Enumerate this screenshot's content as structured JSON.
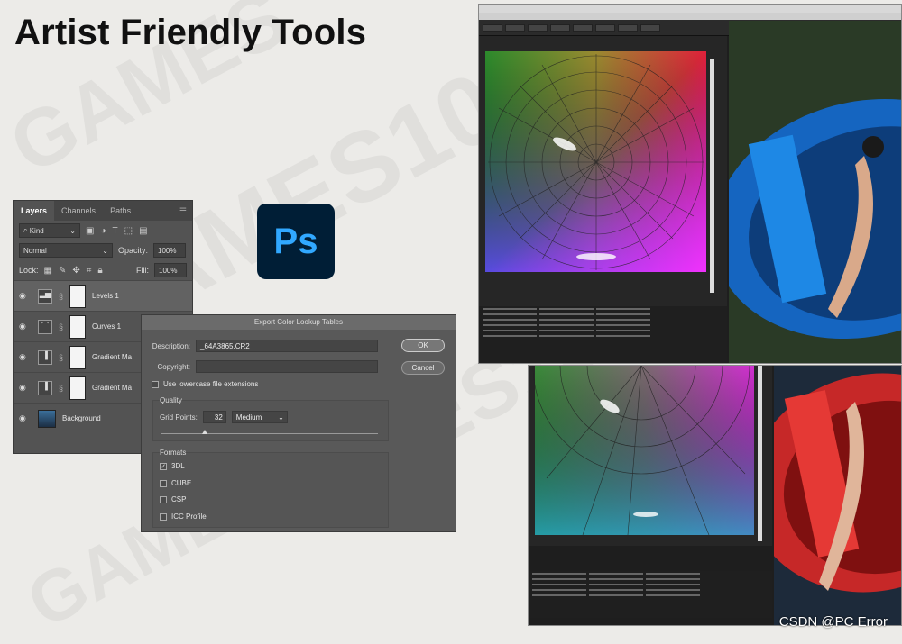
{
  "slide": {
    "title": "Artist Friendly Tools"
  },
  "layers_panel": {
    "tabs": [
      "Layers",
      "Channels",
      "Paths"
    ],
    "filter_kind": "Kind",
    "blend_mode": "Normal",
    "opacity_label": "Opacity:",
    "opacity_value": "100%",
    "lock_label": "Lock:",
    "fill_label": "Fill:",
    "fill_value": "100%",
    "layers": [
      {
        "name": "Levels 1",
        "type": "levels"
      },
      {
        "name": "Curves 1",
        "type": "curves"
      },
      {
        "name": "Gradient Ma",
        "type": "gradient-map"
      },
      {
        "name": "Gradient Ma",
        "type": "gradient-map"
      },
      {
        "name": "Background",
        "type": "background"
      }
    ]
  },
  "ps_logo": {
    "text": "Ps"
  },
  "export_dialog": {
    "title": "Export Color Lookup Tables",
    "description_label": "Description:",
    "description_value": "_64A3865.CR2",
    "copyright_label": "Copyright:",
    "copyright_value": "",
    "lowercase_label": "Use lowercase file extensions",
    "lowercase_checked": false,
    "quality_title": "Quality",
    "grid_points_label": "Grid Points:",
    "grid_points_value": "32",
    "grid_quality": "Medium",
    "quality_slider": 0.2,
    "ok_label": "OK",
    "cancel_label": "Cancel",
    "formats_title": "Formats",
    "formats": [
      {
        "label": "3DL",
        "checked": true
      },
      {
        "label": "CUBE",
        "checked": false
      },
      {
        "label": "CSP",
        "checked": false
      },
      {
        "label": "ICC Profile",
        "checked": false
      }
    ]
  },
  "credit": "CSDN @PC Error",
  "colors": {
    "ps_logo_bg": "#001e36",
    "ps_logo_text": "#31a8ff",
    "boat_blue": "#1565c0",
    "boat_red": "#c62828"
  }
}
